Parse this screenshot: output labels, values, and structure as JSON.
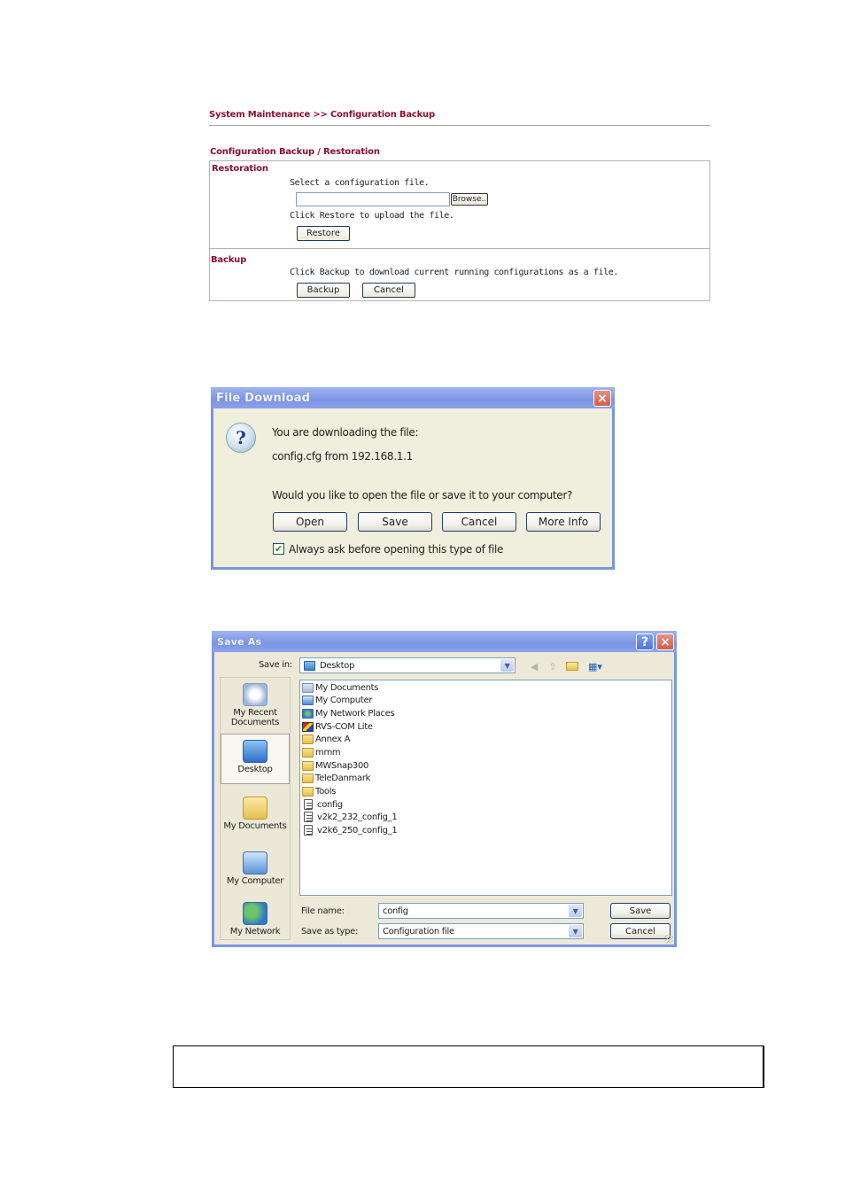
{
  "web_config": {
    "breadcrumb": "System Maintenance >> Configuration Backup",
    "section_title": "Configuration Backup / Restoration",
    "restoration": {
      "label": "Restoration",
      "select_text": "Select a configuration file.",
      "file_input_value": "",
      "browse_label": "Browse..",
      "upload_text": "Click Restore to upload the file.",
      "restore_label": "Restore"
    },
    "backup": {
      "label": "Backup",
      "download_text": "Click Backup to download current running configurations as a file.",
      "backup_label": "Backup",
      "cancel_label": "Cancel"
    }
  },
  "file_download": {
    "title": "File Download",
    "close_icon": "close-icon",
    "question_icon": "question-icon",
    "line1": "You are downloading the file:",
    "line2": "config.cfg from 192.168.1.1",
    "prompt": "Would you like to open the file or save it to your computer?",
    "buttons": {
      "open": "Open",
      "save": "Save",
      "cancel": "Cancel",
      "more_info": "More Info"
    },
    "always_ask_label": "Always ask before opening this type of file",
    "always_ask_checked": true
  },
  "save_as": {
    "title": "Save As",
    "help_icon": "?",
    "close_icon": "×",
    "save_in_label": "Save in:",
    "save_in_value": "Desktop",
    "places": [
      {
        "label": "My Recent Documents",
        "icon": "recent-documents-icon"
      },
      {
        "label": "Desktop",
        "icon": "desktop-icon",
        "selected": true
      },
      {
        "label": "My Documents",
        "icon": "my-documents-icon"
      },
      {
        "label": "My Computer",
        "icon": "my-computer-icon"
      },
      {
        "label": "My Network",
        "icon": "my-network-icon"
      }
    ],
    "files": [
      {
        "name": "My Documents",
        "type": "special-folder"
      },
      {
        "name": "My Computer",
        "type": "computer"
      },
      {
        "name": "My Network Places",
        "type": "network"
      },
      {
        "name": "RVS-COM Lite",
        "type": "shortcut"
      },
      {
        "name": "Annex A",
        "type": "folder"
      },
      {
        "name": "mmm",
        "type": "folder"
      },
      {
        "name": "MWSnap300",
        "type": "folder"
      },
      {
        "name": "TeleDanmark",
        "type": "folder"
      },
      {
        "name": "Tools",
        "type": "folder"
      },
      {
        "name": "config",
        "type": "document"
      },
      {
        "name": "v2k2_232_config_1",
        "type": "document"
      },
      {
        "name": "v2k6_250_config_1",
        "type": "document"
      }
    ],
    "file_name_label": "File name:",
    "file_name_value": "config",
    "save_type_label": "Save as type:",
    "save_type_value": "Configuration file",
    "save_label": "Save",
    "cancel_label": "Cancel"
  }
}
